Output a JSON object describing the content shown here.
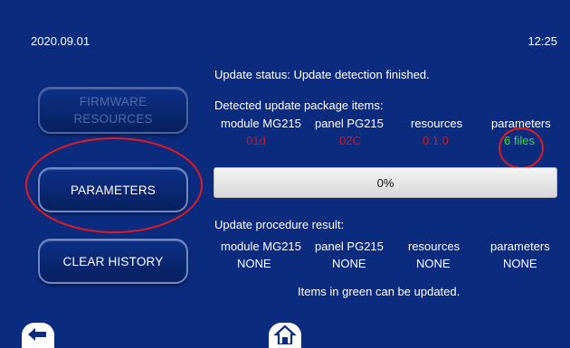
{
  "header": {
    "date": "2020.09.01",
    "time": "12:25"
  },
  "sidebar": {
    "firmware_resources_label": "FIRMWARE\nRESOURCES",
    "parameters_label": "PARAMETERS",
    "clear_history_label": "CLEAR HISTORY"
  },
  "status": {
    "text": "Update status: Update detection finished."
  },
  "detected": {
    "heading": "Detected update package items:",
    "items": [
      {
        "label": "module MG215",
        "value": "01d",
        "value_color": "#d8151c"
      },
      {
        "label": "panel PG215",
        "value": "02C",
        "value_color": "#d8151c"
      },
      {
        "label": "resources",
        "value": "0.1.0",
        "value_color": "#d8151c"
      },
      {
        "label": "parameters",
        "value": "6 files",
        "value_color": "#3ddc2f"
      }
    ]
  },
  "progress": {
    "label": "0%",
    "value": 0
  },
  "result": {
    "heading": "Update procedure result:",
    "items": [
      {
        "label": "module MG215",
        "value": "NONE"
      },
      {
        "label": "panel PG215",
        "value": "NONE"
      },
      {
        "label": "resources",
        "value": "NONE"
      },
      {
        "label": "parameters",
        "value": "NONE"
      }
    ]
  },
  "note": "Items in green can be updated.",
  "icons": {
    "back": "back-arrow-icon",
    "home": "home-icon"
  },
  "colors": {
    "background": "#0a2b7e",
    "highlight_circle": "#e01b24",
    "updatable": "#3ddc2f",
    "not_updatable": "#d8151c"
  }
}
